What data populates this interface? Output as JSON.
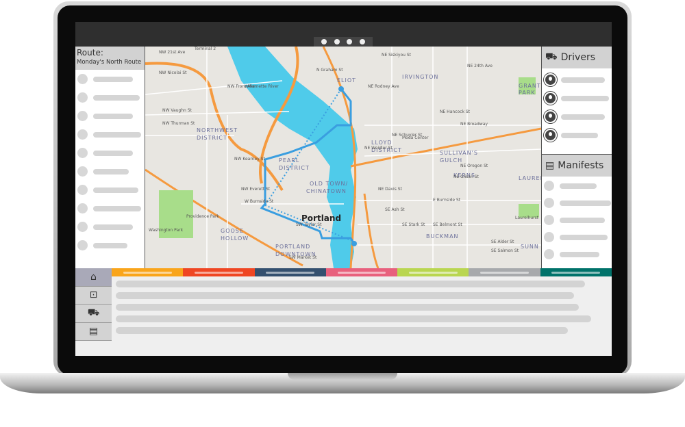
{
  "route": {
    "label": "Route:",
    "name": "Monday's North Route"
  },
  "drivers": {
    "title": "Drivers",
    "icon": "truck-icon",
    "count": 4
  },
  "manifests": {
    "title": "Manifests",
    "icon": "floppy-disk-icon",
    "count": 5
  },
  "map": {
    "city": "Portland",
    "neighborhoods": [
      "NORTHWEST",
      "DISTRICT",
      "PEARL",
      "DISTRICT",
      "OLD TOWN/",
      "CHINATOWN",
      "LLOYD",
      "DISTRICT",
      "IRVINGTON",
      "SULLIVAN'S",
      "GULCH",
      "KERNS",
      "BUCKMAN",
      "GOOSE",
      "HOLLOW",
      "PORTLAND",
      "DOWNTOWN",
      "ELIOT",
      "GRANT",
      "PARK",
      "LAUREL",
      "SUNN"
    ],
    "streets": [
      "Terminal 2",
      "NW Nicolai St",
      "NW Vaughn St",
      "NW Thurman St",
      "NW Front Ave",
      "NW Kearney St",
      "NW Everett St",
      "W Burnside St",
      "NE Broadway",
      "NE Weidler St",
      "NE Schuyler St",
      "NE Hancock St",
      "NE Davis St",
      "NE Glisan St",
      "NE Oregon St",
      "E Burnside St",
      "SE Ash St",
      "SE Stark St",
      "SE Belmont St",
      "SE Alder St",
      "SE Salmon St",
      "SW Taylor St",
      "SW Market St",
      "N Graham St",
      "NE Siskiyou St",
      "NE Rodney Ave",
      "Willamette River",
      "Moda Center",
      "Providence Park",
      "Washington Park",
      "Laurelhurst",
      "NW 21st Ave",
      "NE 24th Ave"
    ],
    "route_color": "#3a9ee0"
  },
  "tab_colors": [
    "#f9a51b",
    "#ef4623",
    "#34506f",
    "#e8607d",
    "#b9d650",
    "#a7a9ac",
    "#00726a"
  ],
  "side_nav": [
    {
      "icon": "home-icon",
      "glyph": "⌂"
    },
    {
      "icon": "inbox-icon",
      "glyph": "⊡"
    },
    {
      "icon": "truck-icon",
      "glyph": "⛟"
    },
    {
      "icon": "floppy-disk-icon",
      "glyph": "▤"
    }
  ]
}
